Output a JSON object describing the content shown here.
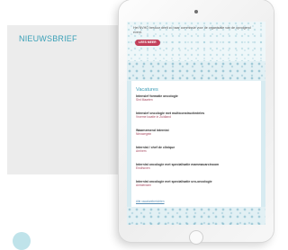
{
  "panel": {
    "title": "NIEUWSBRIEF"
  },
  "newsletter": {
    "intro_text": "Het NVHO bestuur deelt zo haar commissie voor de organisatie van de opvolgend event.",
    "intro_link": "",
    "cta_label": "LEES MEER",
    "section_title": "Vacatures",
    "vacancies": [
      {
        "title": "Intensief formatie oncologie",
        "location": "Sint Maarten"
      },
      {
        "title": "Intensief oncologie met multiconstructiedeles",
        "location": "Vroeme locatie in Zuidland"
      },
      {
        "title": "Waarnemend internist",
        "location": "Nieuwegein"
      },
      {
        "title": "Internist / chef de clinique",
        "location": "Arnhem"
      },
      {
        "title": "Internist oncologie met specialisatie mammacarcinoom",
        "location": "Eindhoven"
      },
      {
        "title": "Internist oncologie met specialisatie uro-oncologie",
        "location": "Amsterdam"
      }
    ],
    "more_link": "Alle vacatureberichten"
  },
  "colors": {
    "accent": "#3aa0b7",
    "button": "#c2405a",
    "location": "#a5475e",
    "panel_bg": "#ececec"
  }
}
